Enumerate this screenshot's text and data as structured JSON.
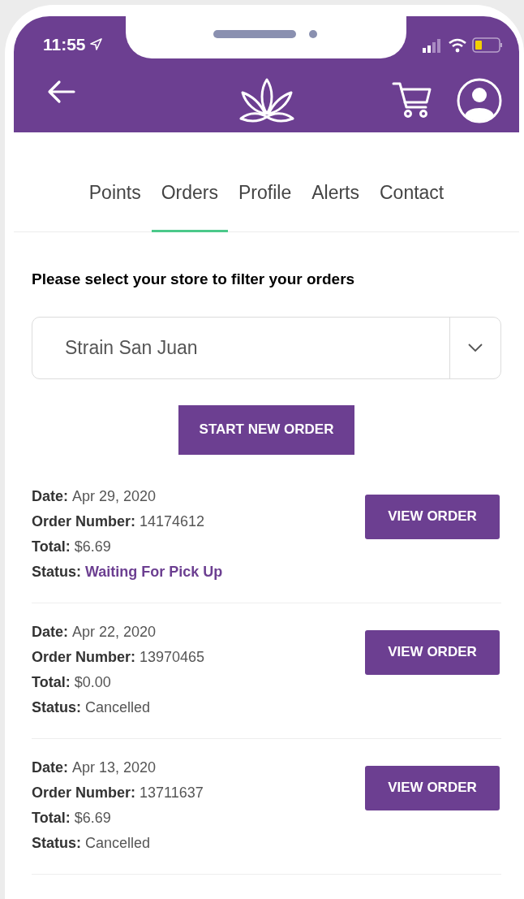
{
  "status_bar": {
    "time": "11:55"
  },
  "tabs": [
    {
      "label": "Points",
      "selected": false
    },
    {
      "label": "Orders",
      "selected": true
    },
    {
      "label": "Profile",
      "selected": false
    },
    {
      "label": "Alerts",
      "selected": false
    },
    {
      "label": "Contact",
      "selected": false
    }
  ],
  "store_filter": {
    "prompt": "Please select your store to filter your orders",
    "value": "Strain San Juan"
  },
  "start_button": "START NEW ORDER",
  "orders": [
    {
      "fields": [
        {
          "label": "Date:",
          "value": "Apr 29, 2020"
        },
        {
          "label": "Order Number:",
          "value": "14174612"
        },
        {
          "label": "Total:",
          "value": "$6.69"
        },
        {
          "label": "Status:",
          "value": "Waiting For Pick Up",
          "highlighted": true
        }
      ],
      "button": "VIEW ORDER"
    },
    {
      "fields": [
        {
          "label": "Date:",
          "value": "Apr 22, 2020"
        },
        {
          "label": "Order Number:",
          "value": "13970465"
        },
        {
          "label": "Total:",
          "value": "$0.00"
        },
        {
          "label": "Status:",
          "value": "Cancelled",
          "highlighted": false
        }
      ],
      "button": "VIEW ORDER"
    },
    {
      "fields": [
        {
          "label": "Date:",
          "value": "Apr 13, 2020"
        },
        {
          "label": "Order Number:",
          "value": "13711637"
        },
        {
          "label": "Total:",
          "value": "$6.69"
        },
        {
          "label": "Status:",
          "value": "Cancelled",
          "highlighted": false
        }
      ],
      "button": "VIEW ORDER"
    }
  ]
}
